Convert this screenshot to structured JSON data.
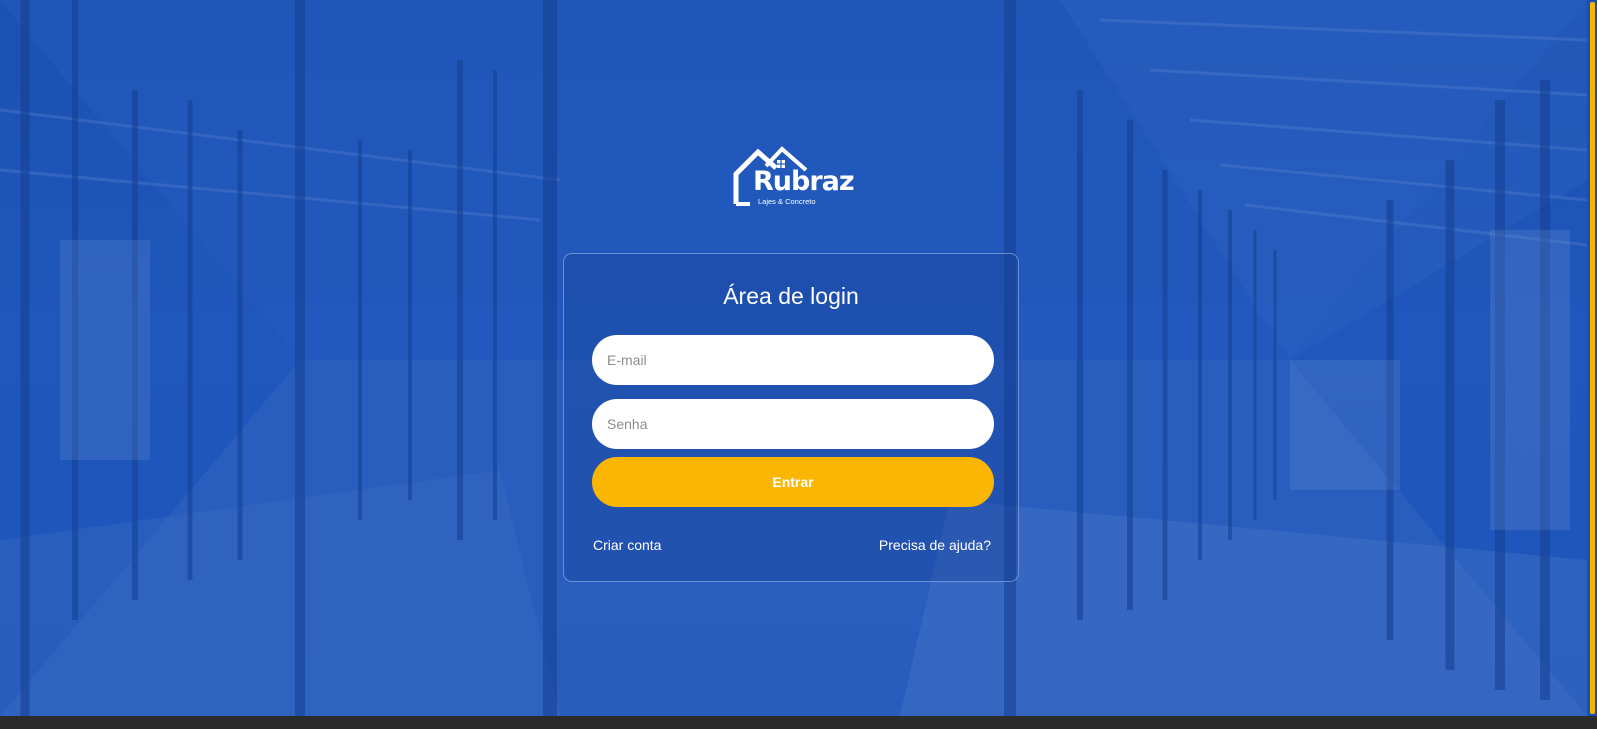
{
  "brand": {
    "name": "Rubraz",
    "tagline": "Lajes & Concreto"
  },
  "login": {
    "title": "Área de login",
    "email_placeholder": "E-mail",
    "password_placeholder": "Senha",
    "submit_label": "Entrar",
    "create_account_label": "Criar conta",
    "help_label": "Precisa de ajuda?"
  },
  "colors": {
    "background_overlay": "#1e56bb",
    "accent": "#fbb604",
    "text": "#ffffff",
    "input_background": "#ffffff"
  },
  "icons": {
    "logo": "house-roof-logo"
  }
}
